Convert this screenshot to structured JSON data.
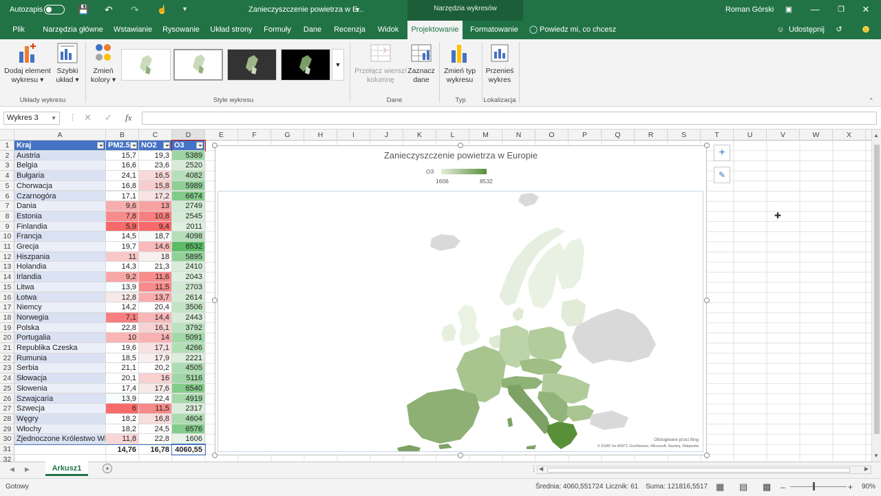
{
  "titlebar": {
    "autosave_label": "Autozapis",
    "doc_title": "Zanieczyszczenie powietrza w E...",
    "context_tools": "Narzędzia wykresów",
    "user": "Roman Górski"
  },
  "tabs": [
    {
      "label": "Plik"
    },
    {
      "label": "Narzędzia główne"
    },
    {
      "label": "Wstawianie"
    },
    {
      "label": "Rysowanie"
    },
    {
      "label": "Układ strony"
    },
    {
      "label": "Formuły"
    },
    {
      "label": "Dane"
    },
    {
      "label": "Recenzja"
    },
    {
      "label": "Widok"
    },
    {
      "label": "Projektowanie"
    },
    {
      "label": "Formatowanie"
    }
  ],
  "tell_me": "Powiedz mi, co chcesz zrobić",
  "share": "Udostępnij",
  "ribbon": {
    "add_element": "Dodaj element wykresu",
    "quick_layout": "Szybki układ",
    "change_colors": "Zmień kolory",
    "group_layouts": "Układy wykresu",
    "group_styles": "Style wykresu",
    "switch_row_col": "Przełącz wiersz/ kolumnę",
    "select_data": "Zaznacz dane",
    "group_data": "Dane",
    "change_type": "Zmień typ wykresu",
    "group_type": "Typ",
    "move_chart": "Przenieś wykres",
    "group_location": "Lokalizacja"
  },
  "formula": {
    "name_box": "Wykres 3",
    "fx": "fx",
    "value": ""
  },
  "columns": [
    "A",
    "B",
    "C",
    "D",
    "E",
    "F",
    "G",
    "H",
    "I",
    "J",
    "K",
    "L",
    "M",
    "N",
    "O",
    "P",
    "Q",
    "R",
    "S",
    "T",
    "U",
    "V",
    "W",
    "X"
  ],
  "table": {
    "headers": [
      "Kraj",
      "PM2.5",
      "NO2",
      "O3"
    ],
    "rows": [
      [
        "Austria",
        "15,7",
        "19,3",
        "5389"
      ],
      [
        "Belgia",
        "16,6",
        "23,6",
        "2520"
      ],
      [
        "Bułgaria",
        "24,1",
        "16,5",
        "4082"
      ],
      [
        "Chorwacja",
        "16,8",
        "15,8",
        "5989"
      ],
      [
        "Czarnogóra",
        "17,1",
        "17,2",
        "6674"
      ],
      [
        "Dania",
        "9,6",
        "13",
        "2749"
      ],
      [
        "Estonia",
        "7,8",
        "10,8",
        "2545"
      ],
      [
        "Finlandia",
        "5,9",
        "9,4",
        "2011"
      ],
      [
        "Francja",
        "14,5",
        "18,7",
        "4098"
      ],
      [
        "Grecja",
        "19,7",
        "14,6",
        "8532"
      ],
      [
        "Hiszpania",
        "11",
        "18",
        "5895"
      ],
      [
        "Holandia",
        "14,3",
        "21,3",
        "2410"
      ],
      [
        "Irlandia",
        "9,2",
        "11,6",
        "2043"
      ],
      [
        "Litwa",
        "13,9",
        "11,5",
        "2703"
      ],
      [
        "Łotwa",
        "12,8",
        "13,7",
        "2614"
      ],
      [
        "Niemcy",
        "14,2",
        "20,4",
        "3506"
      ],
      [
        "Norwegia",
        "7,1",
        "14,4",
        "2443"
      ],
      [
        "Polska",
        "22,8",
        "16,1",
        "3792"
      ],
      [
        "Portugalia",
        "10",
        "14",
        "5091"
      ],
      [
        "Republika Czeska",
        "19,6",
        "17,1",
        "4266"
      ],
      [
        "Rumunia",
        "18,5",
        "17,9",
        "2221"
      ],
      [
        "Serbia",
        "21,1",
        "20,2",
        "4505"
      ],
      [
        "Słowacja",
        "20,1",
        "16",
        "5116"
      ],
      [
        "Słowenia",
        "17,4",
        "17,6",
        "6540"
      ],
      [
        "Szwajcaria",
        "13,9",
        "22,4",
        "4919"
      ],
      [
        "Szwecja",
        "6",
        "11,5",
        "2317"
      ],
      [
        "Węgry",
        "18,2",
        "16,8",
        "4604"
      ],
      [
        "Włochy",
        "18,2",
        "24,5",
        "6576"
      ],
      [
        "Zjednoczone Królestwo Wie",
        "11,8",
        "22,8",
        "1606"
      ]
    ],
    "totals": [
      "",
      "14,76",
      "16,78",
      "4060,55"
    ]
  },
  "chart": {
    "title": "Zanieczyszczenie powietrza w Europie",
    "legend_series": "O3",
    "legend_min": "1606",
    "legend_max": "8532",
    "credit1": "Obsługiwane przez Bing",
    "credit2": "© DSAT for MSFT, GeoNames, Microsoft, Navteq, Wikipedia"
  },
  "chart_colors": {
    "low": "#e4eddb",
    "high": "#5a8f3a",
    "nodata": "#d9d9d9"
  },
  "sheet_tab": "Arkusz1",
  "status": {
    "ready": "Gotowy",
    "average": "Średnia: 4060,551724",
    "count": "Licznik: 61",
    "sum": "Suma: 121816,5517",
    "zoom": "90%"
  }
}
